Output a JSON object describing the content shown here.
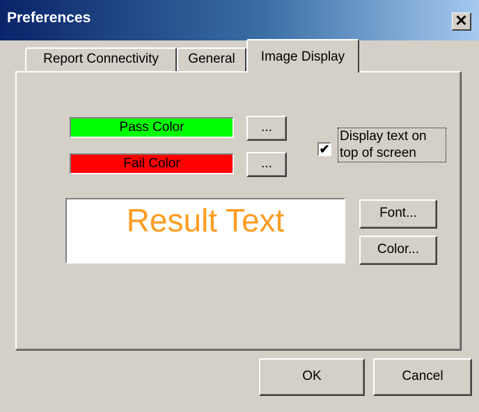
{
  "window": {
    "title": "Preferences",
    "close_glyph": "✕"
  },
  "tabs": [
    {
      "label": "Report Connectivity",
      "active": false
    },
    {
      "label": "General",
      "active": false
    },
    {
      "label": "Image Display",
      "active": true
    }
  ],
  "image_display": {
    "pass_color_label": "Pass Color",
    "pass_color": "#00ff00",
    "fail_color_label": "Fail Color",
    "fail_color": "#ff0000",
    "browse_label": "...",
    "display_text_on_top": {
      "label": "Display text on top of screen",
      "checked": true,
      "check_glyph": "✔"
    },
    "result_text": "Result Text",
    "result_text_color": "#ff9c21",
    "font_button": "Font...",
    "color_button": "Color..."
  },
  "footer": {
    "ok_label": "OK",
    "cancel_label": "Cancel"
  }
}
